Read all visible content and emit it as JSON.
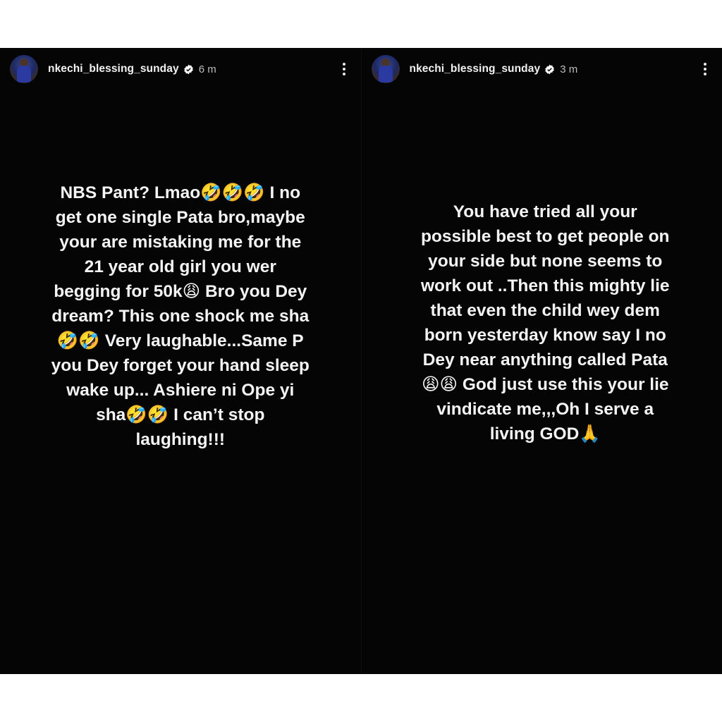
{
  "stories": [
    {
      "username": "nkechi_blessing_sunday",
      "time": "6 m",
      "text": "NBS Pant? Lmao🤣🤣🤣 I no get one single Pata bro,maybe your are mistaking me for the 21 year old girl you wer begging for 50k😩 Bro you Dey dream? This one shock me sha🤣🤣 Very laughable...Same P you Dey forget your hand sleep wake up... Ashiere ni Ope yi sha🤣🤣 I can’t stop laughing!!!"
    },
    {
      "username": "nkechi_blessing_sunday",
      "time": "3 m",
      "text": "You have tried all your possible best to get people on your side but none seems to work out ..Then this mighty lie that even the child wey dem born yesterday know say I no Dey near anything called Pata😩😩 God just use this your lie vindicate me,,,Oh I serve a living GOD🙏"
    }
  ],
  "icons": {
    "verified": "verified-badge-icon",
    "more": "more-options-icon"
  },
  "colors": {
    "background": "#050505",
    "text": "#f4f4f4",
    "verified_badge": "#ffffff"
  }
}
